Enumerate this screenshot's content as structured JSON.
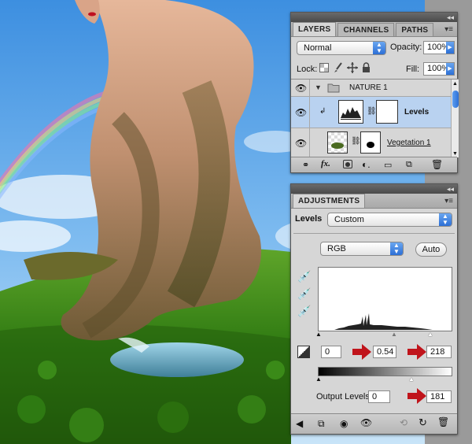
{
  "layers_panel": {
    "tabs": [
      "LAYERS",
      "CHANNELS",
      "PATHS"
    ],
    "blend_mode": "Normal",
    "opacity_label": "Opacity:",
    "opacity_value": "100%",
    "lock_label": "Lock:",
    "fill_label": "Fill:",
    "fill_value": "100%",
    "layers": [
      {
        "name": "NATURE 1",
        "type": "group"
      },
      {
        "name": "Levels",
        "type": "adjustment"
      },
      {
        "name": "Vegetation 1",
        "type": "pixel"
      }
    ]
  },
  "adjustments_panel": {
    "tab": "ADJUSTMENTS",
    "adjustment_label": "Levels",
    "preset": "Custom",
    "channel": "RGB",
    "auto_label": "Auto",
    "input_black": "0",
    "input_gamma": "0.54",
    "input_white": "218",
    "output_label": "Output Levels:",
    "output_black": "0",
    "output_white": "181"
  },
  "icons": {
    "accent_blue": "#2c6fd6",
    "arrow_red": "#c0141b"
  }
}
